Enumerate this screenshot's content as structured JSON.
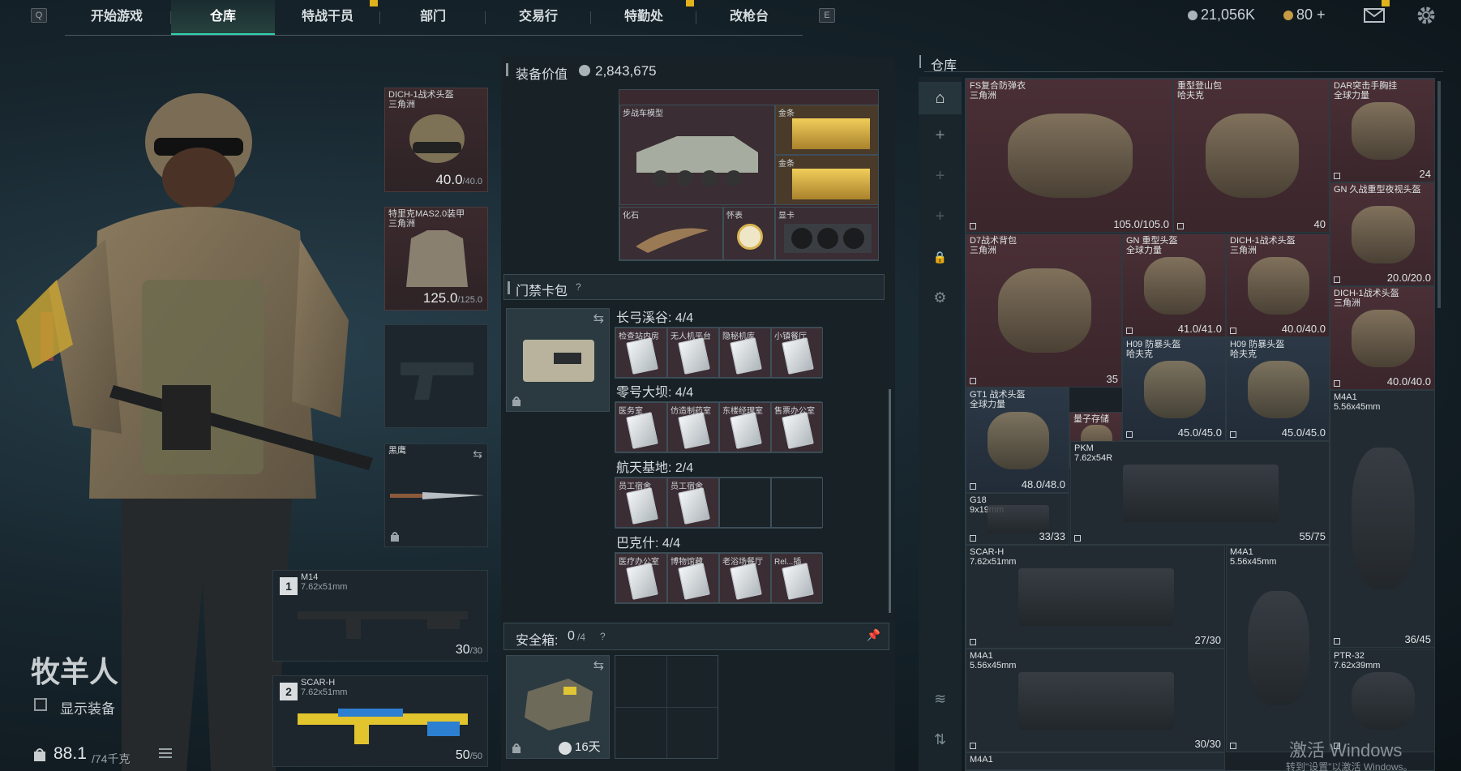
{
  "nav": {
    "left_key": "Q",
    "right_key": "E",
    "tabs": [
      "开始游戏",
      "仓库",
      "特战干员",
      "部门",
      "交易行",
      "特勤处",
      "改枪台"
    ],
    "active_tab": 1
  },
  "currency": {
    "silver": "21,056K",
    "gold": "80 +"
  },
  "operator": {
    "name": "牧羊人",
    "show_equipment": "显示装备",
    "weight_value": "88.1",
    "weight_unit": "/74千克"
  },
  "slots": {
    "helmet": {
      "name": "DICH-1战术头盔\n三角洲",
      "dur": "40.0",
      "max": "/40.0"
    },
    "armor": {
      "name": "特里克MAS2.0装甲\n三角洲",
      "dur": "125.0",
      "max": "/125.0"
    },
    "melee": {
      "name": "黑鹰"
    },
    "primary1": {
      "num": "1",
      "name": "M14",
      "ammo": "7.62x51mm",
      "count": "30",
      "max": "/30"
    },
    "primary2": {
      "num": "2",
      "name": "SCAR-H",
      "ammo": "7.62x51mm",
      "count": "50",
      "max": "/50"
    }
  },
  "equip_value": {
    "label": "装备价值",
    "value": "2,843,675"
  },
  "backpack_items": {
    "ifv": "步战车模型",
    "gold1": "金条",
    "gold2": "金条",
    "fossil": "化石",
    "watch": "怀表",
    "gpu": "显卡"
  },
  "keycard": {
    "title": "门禁卡包",
    "sections": [
      {
        "name": "长弓溪谷: 4/4",
        "cards": [
          "检查站内房",
          "无人机平台",
          "隐秘机库",
          "小镇餐厅"
        ]
      },
      {
        "name": "零号大坝: 4/4",
        "cards": [
          "医务室",
          "仿造制药室",
          "东楼经理室",
          "售票办公室"
        ]
      },
      {
        "name": "航天基地: 2/4",
        "cards": [
          "员工宿舍",
          "员工宿舍"
        ]
      },
      {
        "name": "巴克什: 4/4",
        "cards": [
          "医疗办公室",
          "博物馆藏",
          "老浴场餐厅",
          "Rel...插"
        ]
      }
    ]
  },
  "safe": {
    "label": "安全箱:",
    "value": "0",
    "max": "/4",
    "timer": "16天"
  },
  "stash": {
    "title": "仓库"
  },
  "stash_items": [
    {
      "name": "FS复合防弹衣\n三角洲",
      "dur": "105.0/105.0"
    },
    {
      "name": "重型登山包\n哈夫克",
      "dur": "40"
    },
    {
      "name": "DAR突击手胸挂\n全球力量",
      "dur": "24"
    },
    {
      "name": "GN 久战重型夜视头盔",
      "dur": "20.0/20.0"
    },
    {
      "name": "D7战术背包\n三角洲",
      "dur": "35"
    },
    {
      "name": "GN 重型头盔\n全球力量",
      "dur": "41.0/41.0"
    },
    {
      "name": "DICH-1战术头盔\n三角洲",
      "dur": "40.0/40.0"
    },
    {
      "name": "DICH-1战术头盔\n三角洲",
      "dur": "40.0/40.0"
    },
    {
      "name": "H09 防暴头盔\n哈夫克",
      "dur": "45.0/45.0"
    },
    {
      "name": "H09 防暴头盔\n哈夫克",
      "dur": "45.0/45.0"
    },
    {
      "name": "M4A1\n5.56x45mm",
      "dur": "36/45"
    },
    {
      "name": "GT1 战术头盔\n全球力量",
      "dur": "48.0/48.0"
    },
    {
      "name": "量子存储",
      "dur": ""
    },
    {
      "name": "PKM\n7.62x54R",
      "dur": "55/75"
    },
    {
      "name": "G18\n9x19mm",
      "dur": "33/33"
    },
    {
      "name": "SCAR-H\n7.62x51mm",
      "dur": "27/30"
    },
    {
      "name": "M4A1\n5.56x45mm",
      "dur": ""
    },
    {
      "name": "M4A1\n5.56x45mm",
      "dur": "30/30"
    },
    {
      "name": "PTR-32\n7.62x39mm",
      "dur": ""
    },
    {
      "name": "M4A1",
      "dur": ""
    }
  ],
  "windows_watermark": {
    "line1": "激活 Windows",
    "line2": "转到\"设置\"以激活 Windows。"
  },
  "colors": {
    "accent": "#2fd3b0",
    "flag": "#e0b21b",
    "rarity_red": "#4a3036",
    "rarity_blue": "#2c3846"
  }
}
